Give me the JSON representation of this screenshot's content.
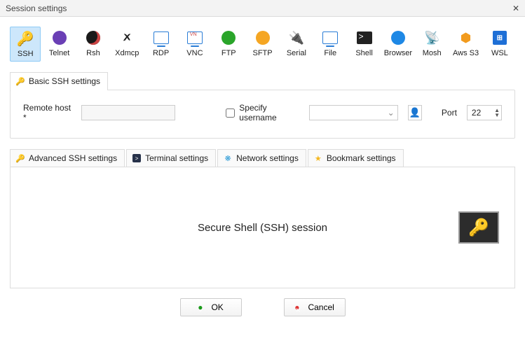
{
  "window": {
    "title": "Session settings"
  },
  "protocols": [
    {
      "id": "ssh",
      "label": "SSH",
      "selected": true
    },
    {
      "id": "telnet",
      "label": "Telnet",
      "selected": false
    },
    {
      "id": "rsh",
      "label": "Rsh",
      "selected": false
    },
    {
      "id": "xdmcp",
      "label": "Xdmcp",
      "selected": false
    },
    {
      "id": "rdp",
      "label": "RDP",
      "selected": false
    },
    {
      "id": "vnc",
      "label": "VNC",
      "selected": false
    },
    {
      "id": "ftp",
      "label": "FTP",
      "selected": false
    },
    {
      "id": "sftp",
      "label": "SFTP",
      "selected": false
    },
    {
      "id": "serial",
      "label": "Serial",
      "selected": false
    },
    {
      "id": "file",
      "label": "File",
      "selected": false
    },
    {
      "id": "shell",
      "label": "Shell",
      "selected": false
    },
    {
      "id": "browser",
      "label": "Browser",
      "selected": false
    },
    {
      "id": "mosh",
      "label": "Mosh",
      "selected": false
    },
    {
      "id": "awss3",
      "label": "Aws S3",
      "selected": false
    },
    {
      "id": "wsl",
      "label": "WSL",
      "selected": false
    }
  ],
  "basic_tab": {
    "label": "Basic SSH settings"
  },
  "basic": {
    "remote_host_label": "Remote host *",
    "remote_host_value": "",
    "specify_username_label": "Specify username",
    "specify_username_checked": false,
    "username_value": "",
    "port_label": "Port",
    "port_value": "22"
  },
  "settings_tabs": [
    {
      "id": "advanced",
      "label": "Advanced SSH settings"
    },
    {
      "id": "terminal",
      "label": "Terminal settings"
    },
    {
      "id": "network",
      "label": "Network settings"
    },
    {
      "id": "bookmark",
      "label": "Bookmark settings"
    }
  ],
  "session": {
    "description": "Secure Shell (SSH) session"
  },
  "buttons": {
    "ok_label": "OK",
    "cancel_label": "Cancel"
  }
}
